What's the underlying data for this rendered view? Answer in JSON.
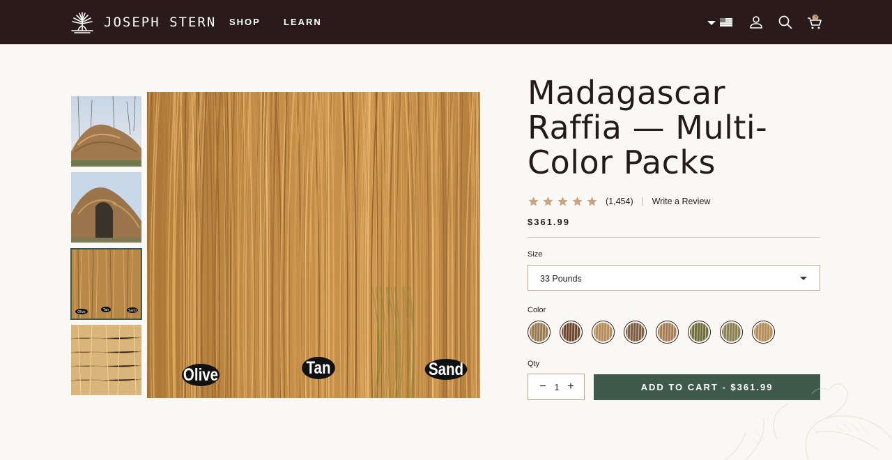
{
  "header": {
    "brand": "JOSEPH STERN",
    "nav": [
      {
        "label": "SHOP"
      },
      {
        "label": "LEARN"
      }
    ],
    "icons": [
      "chevron-down-icon",
      "us-flag-icon",
      "user-icon",
      "search-icon",
      "cart-icon"
    ],
    "cart_count": "0",
    "bg_color": "#2a1a1a"
  },
  "gallery": {
    "thumbnails": [
      "blind-thumbnail",
      "blind-closeup-thumbnail",
      "color-samples-thumbnail",
      "grass-texture-thumbnail"
    ],
    "thumbnail_labels": [
      "Olive",
      "Tan",
      "Sand"
    ],
    "selected_index": 2,
    "main_labels": [
      "Olive",
      "Tan",
      "Sand"
    ]
  },
  "product": {
    "title": "Madagascar Raffia — Multi-Color Packs",
    "rating_stars": 5,
    "rating_count": "(1,454)",
    "write_review": "Write a Review",
    "price": "$361.99",
    "size_label": "Size",
    "size_value": "33 Pounds",
    "color_label": "Color",
    "colors": [
      "#9a7846",
      "#6b4026",
      "#b98a52",
      "#7c5a3c",
      "#a97a4c",
      "#6e6a33",
      "#8a7e4a",
      "#b88b4c"
    ],
    "qty_label": "Qty",
    "qty_value": "1",
    "qty_minus": "−",
    "qty_plus": "+",
    "add_to_cart": "ADD TO CART - $361.99",
    "accent": "#3e5a4a",
    "border_color": "#c8a483"
  }
}
